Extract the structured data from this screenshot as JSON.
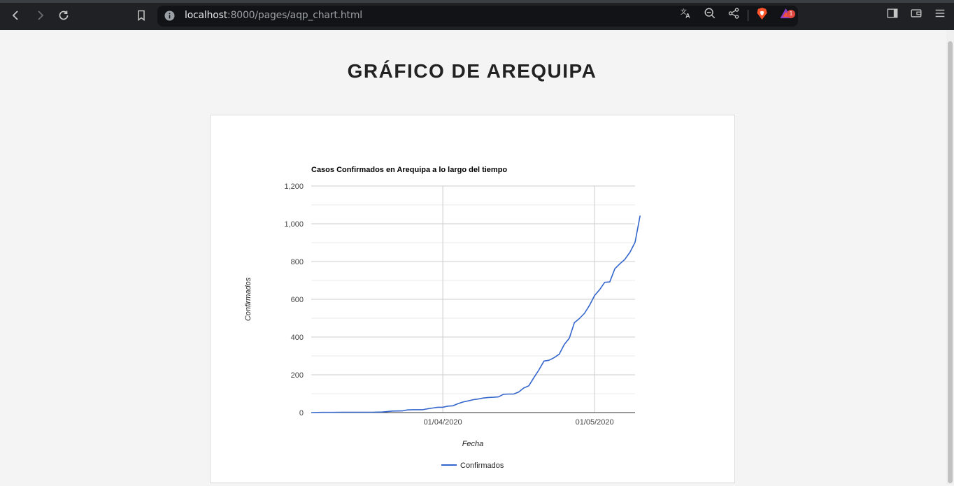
{
  "browser": {
    "url_host": "localhost",
    "url_rest": ":8000/pages/aqp_chart.html",
    "notification_count": "1"
  },
  "page": {
    "title": "GRÁFICO DE AREQUIPA"
  },
  "chart_data": {
    "type": "line",
    "title": "Casos Confirmados en Arequipa a lo largo del tiempo",
    "xlabel": "Fecha",
    "ylabel": "Confirmados",
    "ylim": [
      0,
      1200
    ],
    "yticks": [
      "0",
      "200",
      "400",
      "600",
      "800",
      "1,000",
      "1,200"
    ],
    "xticks": [
      {
        "label": "01/04/2020",
        "date": "2020-04-01"
      },
      {
        "label": "01/05/2020",
        "date": "2020-05-01"
      }
    ],
    "xlim": [
      "2020-03-06",
      "2020-05-09"
    ],
    "grid": true,
    "legend_position": "bottom",
    "series": [
      {
        "name": "Confirmados",
        "color": "#3366cc",
        "points": [
          [
            "2020-03-06",
            0
          ],
          [
            "2020-03-08",
            1
          ],
          [
            "2020-03-10",
            1
          ],
          [
            "2020-03-12",
            2
          ],
          [
            "2020-03-14",
            2
          ],
          [
            "2020-03-16",
            2
          ],
          [
            "2020-03-18",
            2
          ],
          [
            "2020-03-20",
            3
          ],
          [
            "2020-03-21",
            5
          ],
          [
            "2020-03-22",
            8
          ],
          [
            "2020-03-24",
            9
          ],
          [
            "2020-03-25",
            14
          ],
          [
            "2020-03-26",
            15
          ],
          [
            "2020-03-28",
            15
          ],
          [
            "2020-03-29",
            20
          ],
          [
            "2020-03-30",
            24
          ],
          [
            "2020-03-31",
            28
          ],
          [
            "2020-04-01",
            28
          ],
          [
            "2020-04-02",
            34
          ],
          [
            "2020-04-03",
            36
          ],
          [
            "2020-04-04",
            47
          ],
          [
            "2020-04-05",
            56
          ],
          [
            "2020-04-06",
            62
          ],
          [
            "2020-04-07",
            68
          ],
          [
            "2020-04-08",
            72
          ],
          [
            "2020-04-09",
            77
          ],
          [
            "2020-04-10",
            80
          ],
          [
            "2020-04-11",
            81
          ],
          [
            "2020-04-12",
            83
          ],
          [
            "2020-04-13",
            97
          ],
          [
            "2020-04-14",
            98
          ],
          [
            "2020-04-15",
            98
          ],
          [
            "2020-04-16",
            109
          ],
          [
            "2020-04-17",
            130
          ],
          [
            "2020-04-18",
            142
          ],
          [
            "2020-04-19",
            185
          ],
          [
            "2020-04-20",
            226
          ],
          [
            "2020-04-21",
            273
          ],
          [
            "2020-04-22",
            277
          ],
          [
            "2020-04-23",
            291
          ],
          [
            "2020-04-24",
            309
          ],
          [
            "2020-04-25",
            360
          ],
          [
            "2020-04-26",
            394
          ],
          [
            "2020-04-27",
            476
          ],
          [
            "2020-04-28",
            498
          ],
          [
            "2020-04-29",
            526
          ],
          [
            "2020-04-30",
            568
          ],
          [
            "2020-05-01",
            620
          ],
          [
            "2020-05-02",
            651
          ],
          [
            "2020-05-03",
            690
          ],
          [
            "2020-05-04",
            692
          ],
          [
            "2020-05-05",
            762
          ],
          [
            "2020-05-06",
            788
          ],
          [
            "2020-05-07",
            812
          ],
          [
            "2020-05-08",
            850
          ],
          [
            "2020-05-09",
            902
          ],
          [
            "2020-05-10",
            1043
          ]
        ]
      }
    ]
  }
}
